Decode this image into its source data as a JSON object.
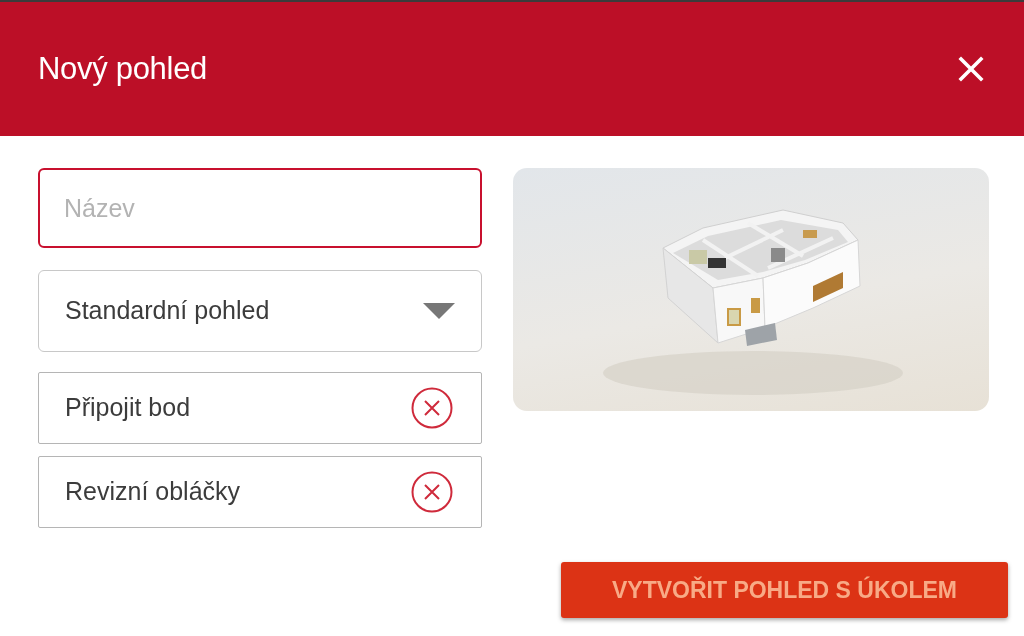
{
  "dialog": {
    "title": "Nový pohled"
  },
  "form": {
    "name_field": {
      "placeholder": "Název",
      "focused": true
    },
    "view_select": {
      "value": "Standardní pohled"
    },
    "attached_items": [
      {
        "label": "Připojit bod"
      },
      {
        "label": "Revizní obláčky"
      }
    ]
  },
  "actions": [
    {
      "label": "VYTVOŘIT POHLED S ÚKOLEM"
    }
  ]
}
